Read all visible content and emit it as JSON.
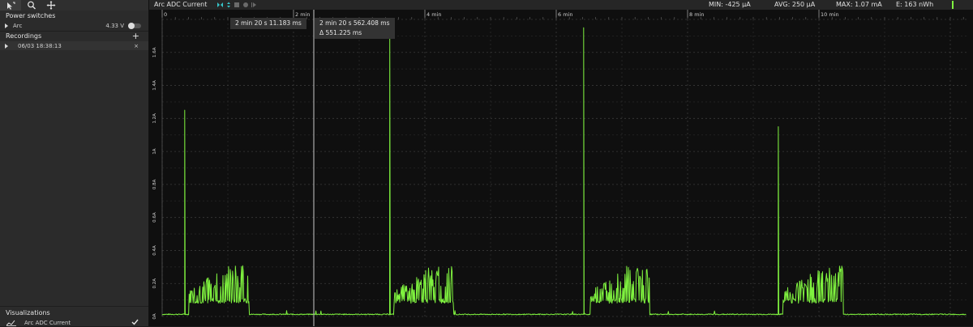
{
  "app": {
    "power_switches_title": "Power switches",
    "switch_name": "Arc",
    "switch_voltage": "4.33 V",
    "recordings_title": "Recordings",
    "recording_name": "06/03 18:38:13",
    "recording_close": "×",
    "visualizations_title": "Visualizations",
    "visualization_name": "Arc ADC Current",
    "add_symbol": "+"
  },
  "topbar": {
    "plot_title": "Arc ADC Current",
    "min": "MIN: -425 µA",
    "avg": "AVG: 250 µA",
    "max": "MAX: 1.07 mA",
    "energy": "E: 163 nWh"
  },
  "cursors": {
    "left": "2 min 20 s 11.183 ms",
    "right": "2 min 20 s 562.408 ms",
    "delta": "Δ 551.225 ms"
  },
  "colors": {
    "trace": "#7ff23f",
    "accent": "#36c4c8",
    "background": "#0f0f0f"
  },
  "chart_data": {
    "type": "line",
    "x_tick_labels": [
      "0",
      "2 min",
      "4 min",
      "6 min",
      "8 min",
      "10 min"
    ],
    "y_tick_labels": [
      "0A",
      "0.2A",
      "0.4A",
      "0.6A",
      "0.8A",
      "1A",
      "1.2A",
      "1.4A",
      "1.6A"
    ],
    "ylim": [
      0,
      1.8
    ],
    "grid": true,
    "series": [
      {
        "bursts": [
          {
            "spike_x": 0.028,
            "spike_y": 1.25,
            "burst_start": 0.033,
            "burst_end": 0.108
          },
          {
            "spike_x": 0.283,
            "spike_y": 1.71,
            "burst_start": 0.288,
            "burst_end": 0.362
          },
          {
            "spike_x": 0.524,
            "spike_y": 1.75,
            "burst_start": 0.532,
            "burst_end": 0.606
          },
          {
            "spike_x": 0.766,
            "spike_y": 1.15,
            "burst_start": 0.772,
            "burst_end": 0.847
          }
        ],
        "baseline": 0.01,
        "burst_base": 0.08,
        "burst_peak": 0.27
      }
    ]
  }
}
